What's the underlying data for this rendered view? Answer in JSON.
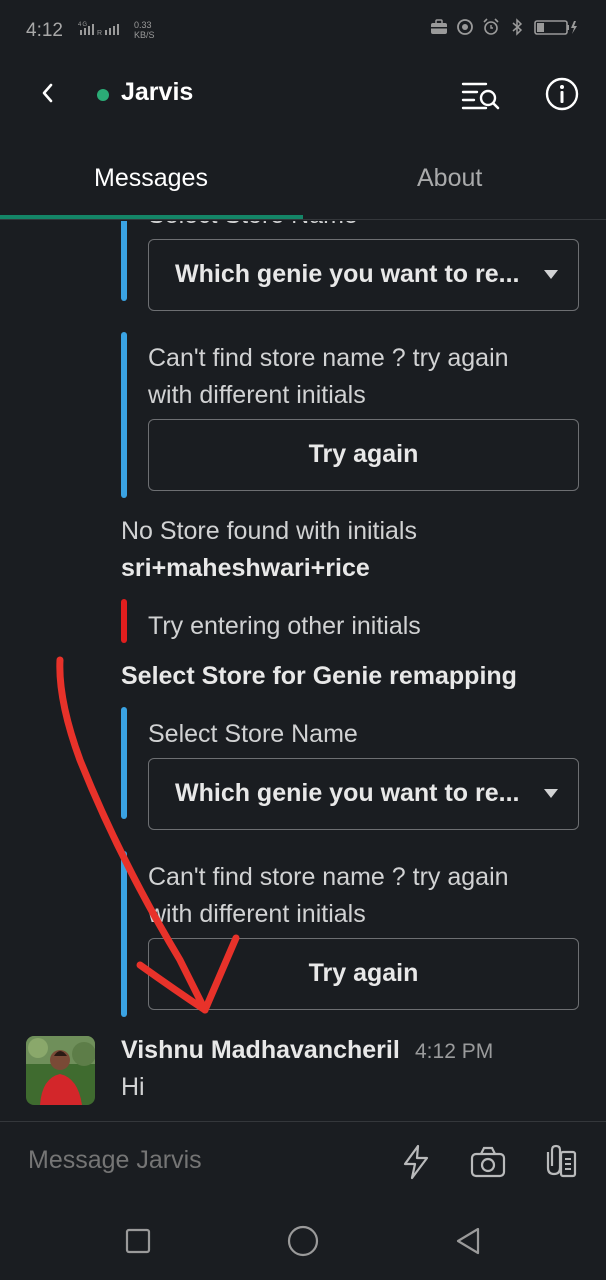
{
  "status_bar": {
    "time": "4:12",
    "network": "4G",
    "speed_value": "0.33",
    "speed_unit": "KB/S"
  },
  "header": {
    "title": "Jarvis",
    "presence_color": "#2bac76",
    "icons": [
      "back-arrow-icon",
      "search-messages-icon",
      "info-icon"
    ]
  },
  "tabs": [
    {
      "label": "Messages",
      "active": true
    },
    {
      "label": "About",
      "active": false
    }
  ],
  "messages": {
    "select_label_top": "Select Store Name",
    "select_placeholder_1": "Which genie you want to re...",
    "cant_find_line1": "Can't find store name ? try again",
    "cant_find_line2": "with different initials",
    "try_again_label": "Try again",
    "no_store_line1": "No Store found with initials",
    "no_store_initials": "sri+maheshwari+rice",
    "try_other_initials": "Try entering other initials",
    "remap_heading": "Select Store for Genie remapping",
    "select_label_2": "Select Store Name",
    "select_placeholder_2": "Which genie you want to re...",
    "cant_find2_line1": "Can't find store name ? try again",
    "cant_find2_line2": "with different initials",
    "try_again_label_2": "Try again",
    "sender_name": "Vishnu Madhavancheril",
    "sender_time": "4:12 PM",
    "sender_message": "Hi"
  },
  "composer": {
    "placeholder": "Message Jarvis",
    "icons": [
      "lightning-icon",
      "camera-icon",
      "attachment-icon"
    ]
  },
  "navbar": {
    "icons": [
      "recents-square-icon",
      "home-circle-icon",
      "back-triangle-icon"
    ]
  },
  "colors": {
    "background": "#1a1d21",
    "accent_bar": "#3aa3e3",
    "error_bar": "#e01e1e",
    "tab_indicator": "#148567",
    "annotation_arrow": "#e8322a"
  }
}
